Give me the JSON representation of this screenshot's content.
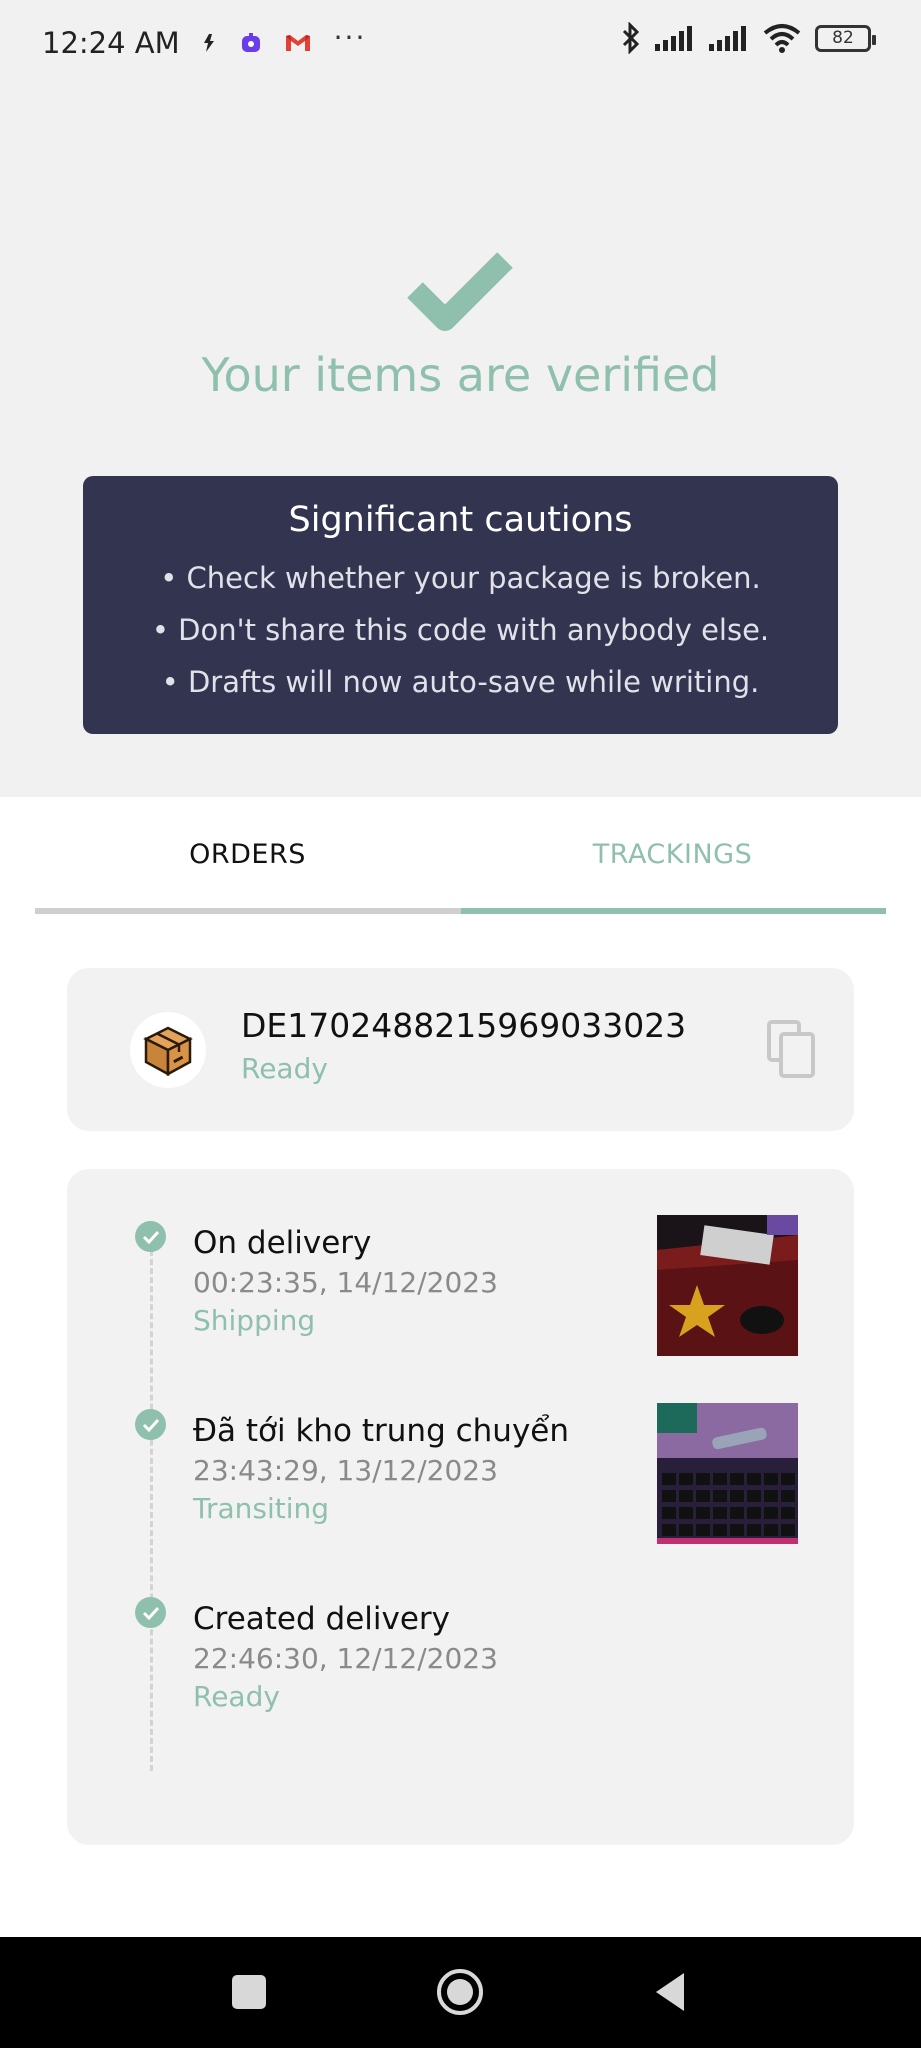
{
  "status_bar": {
    "time": "12:24 AM",
    "battery": "82",
    "left_icons": [
      "app-icon",
      "app-icon",
      "gmail-icon",
      "more-dots-icon"
    ],
    "right_icons": [
      "bluetooth-icon",
      "signal-icon",
      "signal-icon",
      "wifi-icon",
      "battery-icon"
    ]
  },
  "header": {
    "title": "Your items are verified",
    "icon": "checkmark-icon",
    "accent_color": "#8fc0ad"
  },
  "cautions": {
    "title": "Significant cautions",
    "items": [
      "• Check whether your package is broken.",
      "• Don't share this code with anybody else.",
      "• Drafts will now auto-save while writing."
    ],
    "background_color": "#323450"
  },
  "tabs": [
    {
      "label": "ORDERS",
      "active": false
    },
    {
      "label": "TRACKINGS",
      "active": true
    }
  ],
  "tracking": {
    "code": "DE1702488215969033023",
    "status": "Ready",
    "avatar_icon": "package-box-icon",
    "copy_icon": "copy-icon"
  },
  "timeline": [
    {
      "title": "On delivery",
      "time": "00:23:35, 14/12/2023",
      "status": "Shipping",
      "has_image": true
    },
    {
      "title": "Đã tới kho trung chuyển",
      "time": "23:43:29, 13/12/2023",
      "status": "Transiting",
      "has_image": true
    },
    {
      "title": "Created delivery",
      "time": "22:46:30, 12/12/2023",
      "status": "Ready",
      "has_image": false
    }
  ],
  "navbar": {
    "icons": [
      "recent-apps-icon",
      "home-icon",
      "back-icon"
    ]
  }
}
